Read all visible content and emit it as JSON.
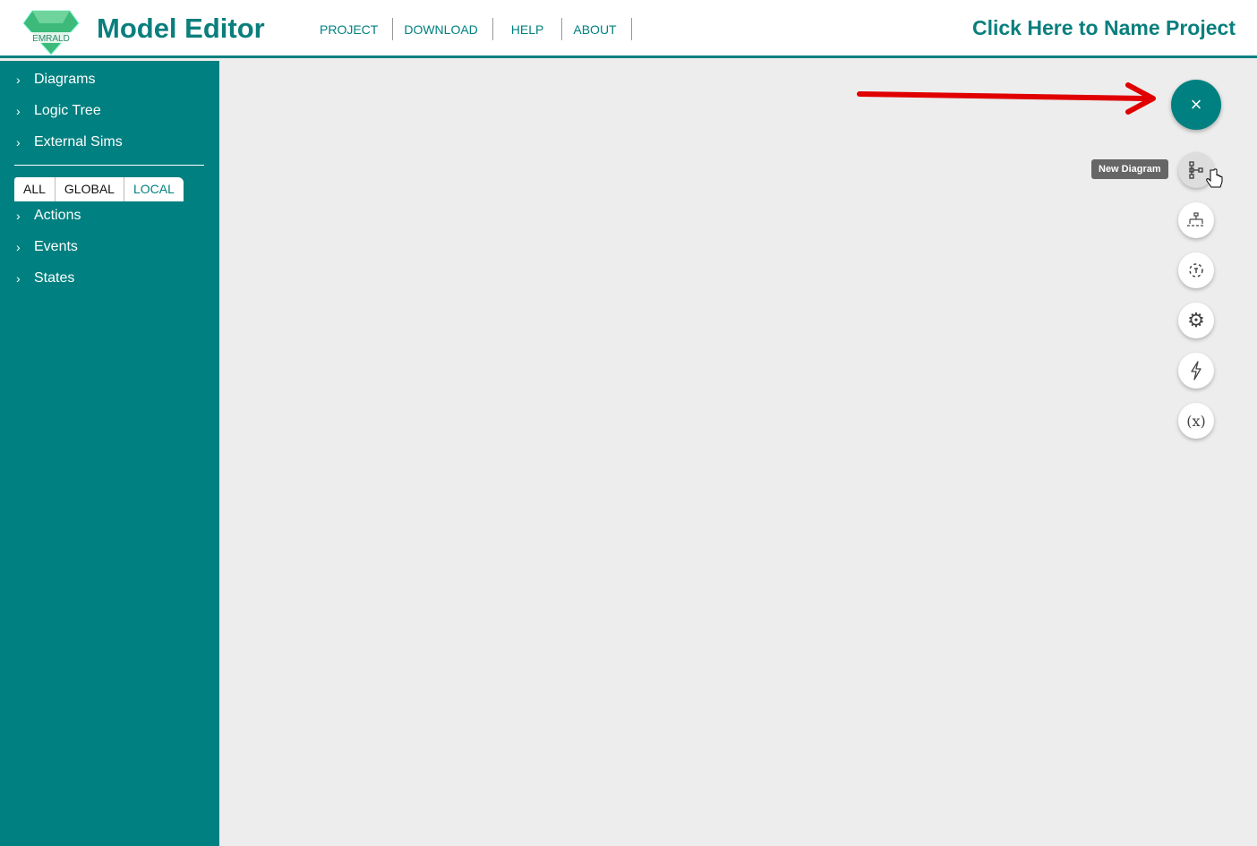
{
  "header": {
    "logo_text": "EMRALD",
    "title": "Model Editor",
    "nav": [
      "PROJECT",
      "DOWNLOAD",
      "HELP",
      "ABOUT"
    ],
    "project_name": "Click Here to Name Project"
  },
  "sidebar": {
    "top_items": [
      "Diagrams",
      "Logic Tree",
      "External Sims"
    ],
    "filters": [
      "ALL",
      "GLOBAL",
      "LOCAL"
    ],
    "active_filter": "LOCAL",
    "bottom_items": [
      "Actions",
      "Events",
      "States"
    ]
  },
  "fab": {
    "close_label": "×",
    "tooltip": "New Diagram",
    "actions": [
      {
        "icon": "diagram-icon"
      },
      {
        "icon": "logic-tree-icon"
      },
      {
        "icon": "external-sim-icon"
      },
      {
        "icon": "gear-icon"
      },
      {
        "icon": "lightning-icon"
      },
      {
        "icon": "variable-icon",
        "label": "(x)"
      }
    ]
  },
  "colors": {
    "accent": "#008080",
    "arrow": "#e00000"
  }
}
